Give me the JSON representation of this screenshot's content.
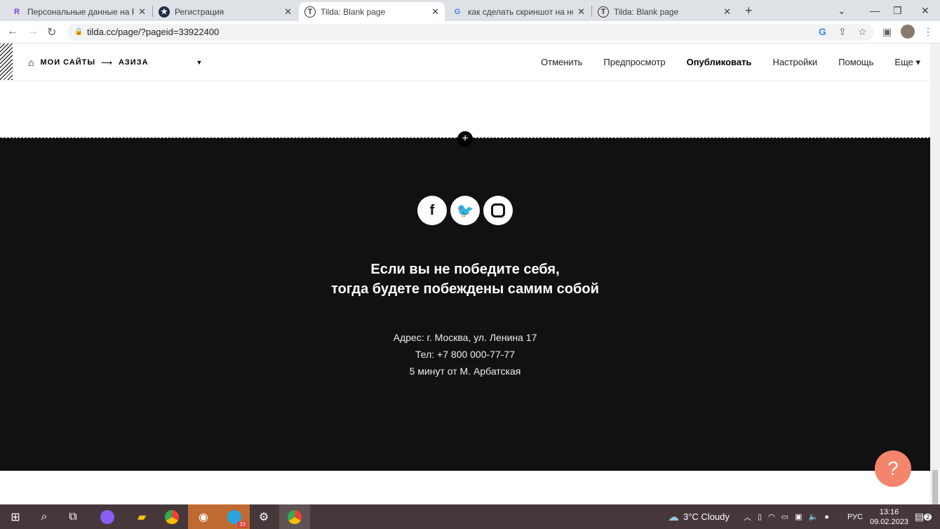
{
  "browser": {
    "tabs": [
      {
        "title": "Персональные данные на Freel",
        "icon": "R"
      },
      {
        "title": "Регистрация",
        "icon": "★"
      },
      {
        "title": "Tilda: Blank page",
        "icon": "T"
      },
      {
        "title": "как сделать скриншот на ноутб",
        "icon": "G"
      },
      {
        "title": "Tilda: Blank page",
        "icon": "T"
      }
    ],
    "url": "tilda.cc/page/?pageid=33922400"
  },
  "tilda": {
    "breadcrumb": {
      "sites": "МОИ САЙТЫ",
      "arrow": "⟶",
      "project": "АЗИЗА"
    },
    "menu": [
      "Отменить",
      "Предпросмотр",
      "Опубликовать",
      "Настройки",
      "Помощь",
      "Еще ▾"
    ]
  },
  "footer": {
    "quote_line1": "Если вы не победите себя,",
    "quote_line2": "тогда будете побеждены самим собой",
    "address": "Адрес: г. Москва, ул. Ленина 17",
    "phone": "Тел: +7 800 000-77-77",
    "metro": "5 минут от М. Арбатская",
    "accent": "#f4846c"
  },
  "taskbar": {
    "weather": "3°C  Cloudy",
    "lang": "РУС",
    "time": "13:16",
    "date": "09.02.2023",
    "notifications": "2",
    "telegram_badge": "33"
  }
}
